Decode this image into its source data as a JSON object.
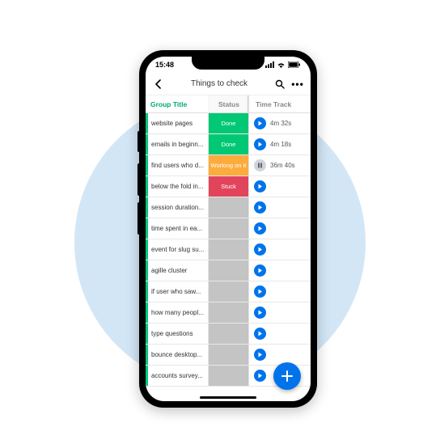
{
  "statusbar": {
    "time": "15:48"
  },
  "nav": {
    "title": "Things to check"
  },
  "columns": {
    "group": "Group Title",
    "status": "Status",
    "time": "Time Track"
  },
  "colors": {
    "done": "#00c875",
    "working": "#fdab3d",
    "stuck": "#e2445c",
    "empty": "#c4c4c4",
    "accent": "#0073ea",
    "groupAccent": "#00a877"
  },
  "rows": [
    {
      "task": "website pages",
      "status": "Done",
      "statusKey": "done",
      "time": "4m 32s",
      "playing": false
    },
    {
      "task": "emails in beginn...",
      "status": "Done",
      "statusKey": "done",
      "time": "4m 18s",
      "playing": false
    },
    {
      "task": "find users who d...",
      "status": "Working on it",
      "statusKey": "working",
      "time": "36m 40s",
      "playing": true
    },
    {
      "task": "below the fold in...",
      "status": "Stuck",
      "statusKey": "stuck",
      "time": "",
      "playing": false
    },
    {
      "task": "session duration...",
      "status": "",
      "statusKey": "empty",
      "time": "",
      "playing": false
    },
    {
      "task": "time spent in ea...",
      "status": "",
      "statusKey": "empty",
      "time": "",
      "playing": false
    },
    {
      "task": "event for slug su...",
      "status": "",
      "statusKey": "empty",
      "time": "",
      "playing": false
    },
    {
      "task": "agille cluster",
      "status": "",
      "statusKey": "empty",
      "time": "",
      "playing": false
    },
    {
      "task": "if user who saw...",
      "status": "",
      "statusKey": "empty",
      "time": "",
      "playing": false
    },
    {
      "task": "how many peopl...",
      "status": "",
      "statusKey": "empty",
      "time": "",
      "playing": false
    },
    {
      "task": "type questions",
      "status": "",
      "statusKey": "empty",
      "time": "",
      "playing": false
    },
    {
      "task": "bounce desktop...",
      "status": "",
      "statusKey": "empty",
      "time": "",
      "playing": false
    },
    {
      "task": "accounts survey...",
      "status": "",
      "statusKey": "empty",
      "time": "",
      "playing": false
    }
  ]
}
